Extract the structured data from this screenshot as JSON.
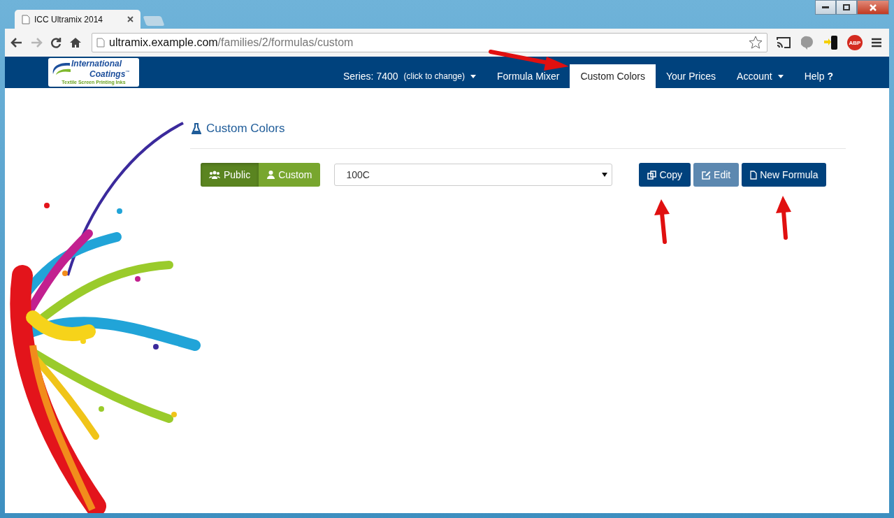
{
  "browser": {
    "tab_title": "ICC Ultramix 2014",
    "url_host": "ultramix.example.com",
    "url_path": "/families/2/formulas/custom",
    "nav_buttons": [
      {
        "kind": "back",
        "disabled": false
      },
      {
        "kind": "forward",
        "disabled": true
      },
      {
        "kind": "reload",
        "disabled": false
      },
      {
        "kind": "home",
        "disabled": false
      }
    ],
    "extensions": [
      {
        "kind": "cast"
      },
      {
        "kind": "chat"
      },
      {
        "kind": "phone"
      },
      {
        "kind": "abp",
        "label": "ABP"
      },
      {
        "kind": "menu"
      }
    ]
  },
  "logo": {
    "line1": "International",
    "line2": "Coatings",
    "mark": "™",
    "tagline": "Textile Screen Printing Inks"
  },
  "navbar": [
    {
      "label": "Series: 7400",
      "note": "(click to change)",
      "dropdown": true,
      "selected": false
    },
    {
      "label": "Formula Mixer",
      "dropdown": false,
      "selected": false
    },
    {
      "label": "Custom Colors",
      "dropdown": false,
      "selected": true
    },
    {
      "label": "Your Prices",
      "dropdown": false,
      "selected": false
    },
    {
      "label": "Account",
      "dropdown": true,
      "selected": false
    },
    {
      "label": "Help",
      "icon_text": "?",
      "dropdown": false,
      "selected": false
    }
  ],
  "heading": "Custom Colors",
  "scope_toggle": [
    {
      "label": "Public",
      "kind": "group",
      "selected": true
    },
    {
      "label": "Custom",
      "kind": "user",
      "selected": false
    }
  ],
  "formula_select": {
    "value": "100C"
  },
  "actions": [
    {
      "label": "Copy",
      "kind": "copy",
      "disabled": false
    },
    {
      "label": "Edit",
      "kind": "edit",
      "disabled": true
    },
    {
      "label": "New Formula",
      "kind": "new",
      "disabled": false
    }
  ]
}
